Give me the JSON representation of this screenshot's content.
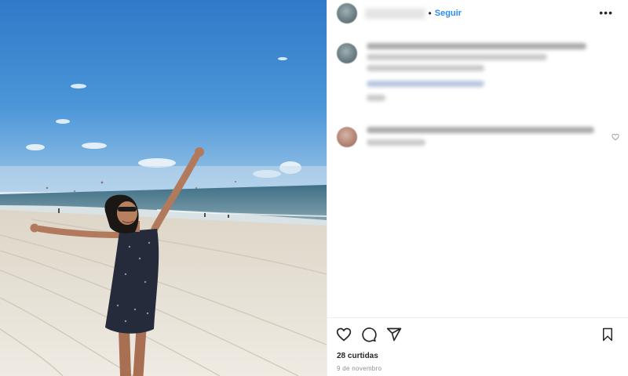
{
  "post": {
    "follow_label": "Seguir",
    "more_label": "•••",
    "dot": "•",
    "likes_text": "28 curtidas",
    "date_text": "9 de novembro"
  },
  "icons": {
    "like": "heart-icon",
    "comment": "comment-icon",
    "share": "share-icon",
    "save": "bookmark-icon",
    "options": "more-icon"
  },
  "colors": {
    "accent": "#2d8ef0",
    "sky": "#3a86d4",
    "sand": "#e9e5dc"
  }
}
